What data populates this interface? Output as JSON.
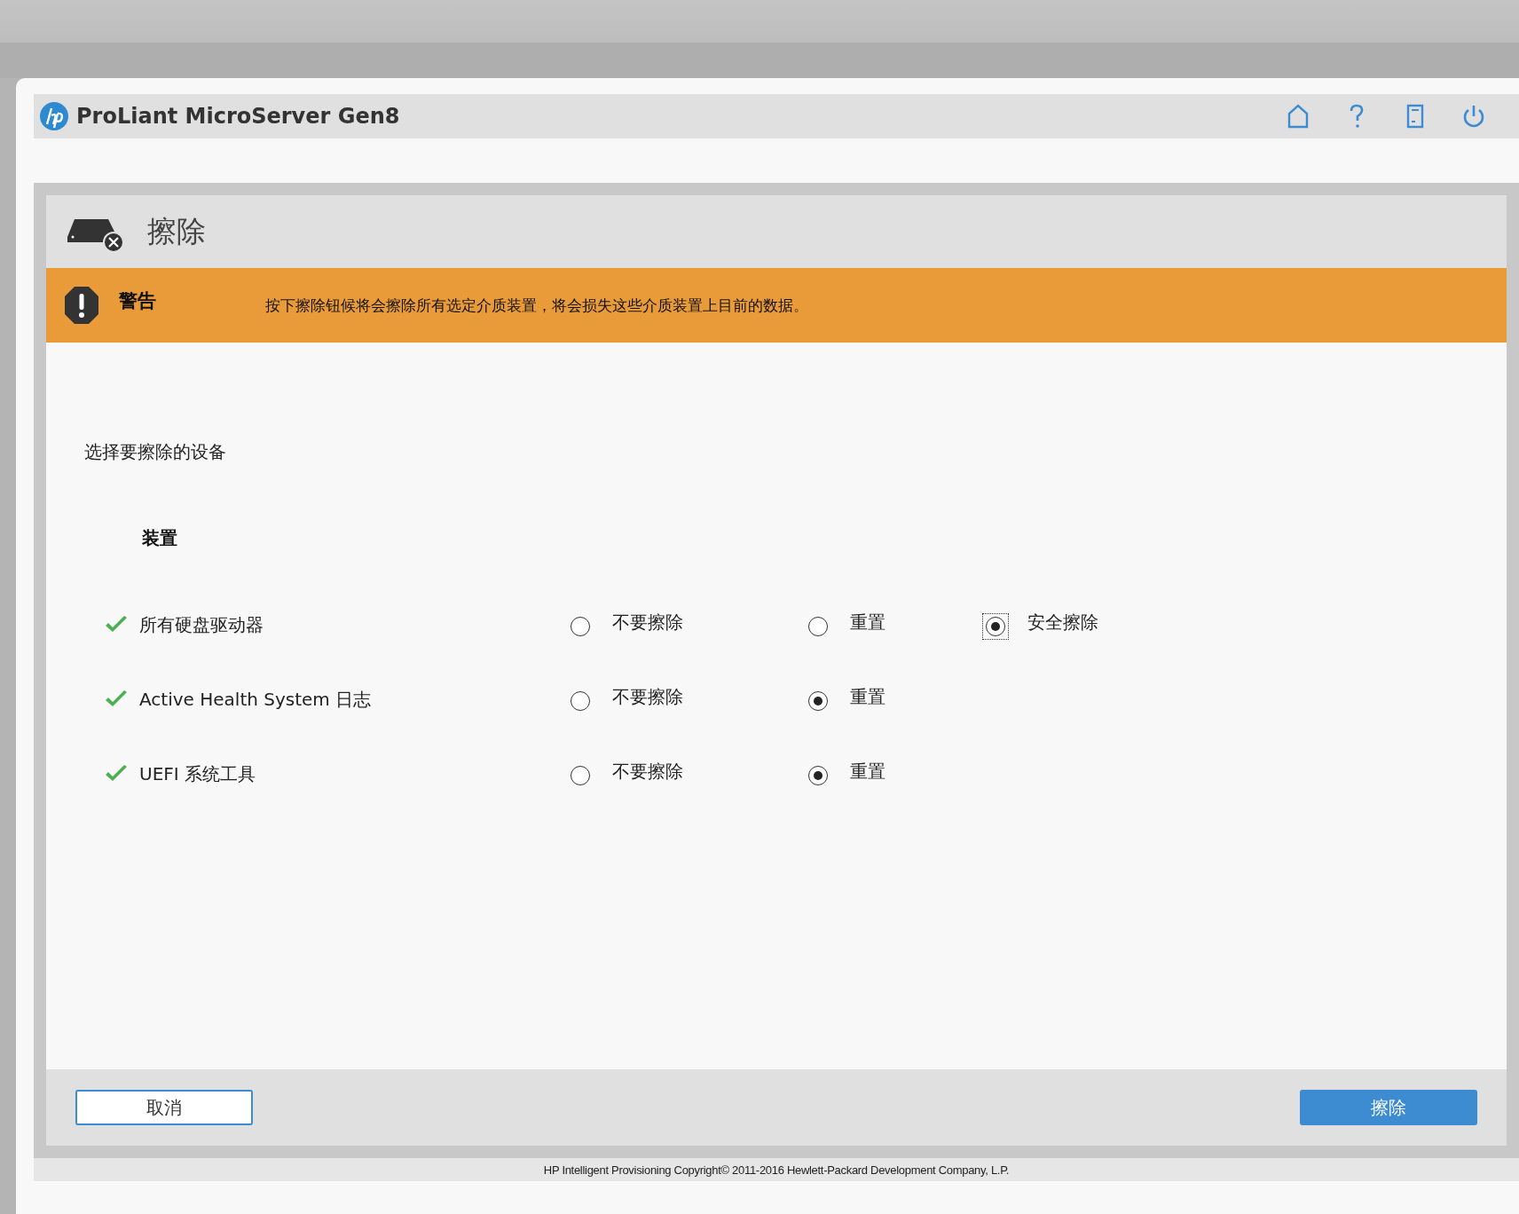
{
  "header": {
    "title": "ProLiant MicroServer Gen8"
  },
  "section": {
    "title": "擦除"
  },
  "warning": {
    "label": "警告",
    "text": "按下擦除钮候将会擦除所有选定介质装置，将会损失这些介质装置上目前的数据。"
  },
  "prompt": "选择要擦除的设备",
  "column_heading": "装置",
  "devices": [
    {
      "label": "所有硬盘驱动器",
      "checked": true,
      "options": [
        {
          "label": "不要擦除",
          "selected": false,
          "focused": false
        },
        {
          "label": "重置",
          "selected": false,
          "focused": false
        },
        {
          "label": "安全擦除",
          "selected": true,
          "focused": true
        }
      ]
    },
    {
      "label": "Active Health System 日志",
      "checked": true,
      "options": [
        {
          "label": "不要擦除",
          "selected": false,
          "focused": false
        },
        {
          "label": "重置",
          "selected": true,
          "focused": false
        }
      ]
    },
    {
      "label": "UEFI 系统工具",
      "checked": true,
      "options": [
        {
          "label": "不要擦除",
          "selected": false,
          "focused": false
        },
        {
          "label": "重置",
          "selected": true,
          "focused": false
        }
      ]
    }
  ],
  "buttons": {
    "cancel": "取消",
    "erase": "擦除"
  },
  "footer": "HP Intelligent Provisioning Copyright© 2011-2016 Hewlett-Packard Development Company, L.P."
}
